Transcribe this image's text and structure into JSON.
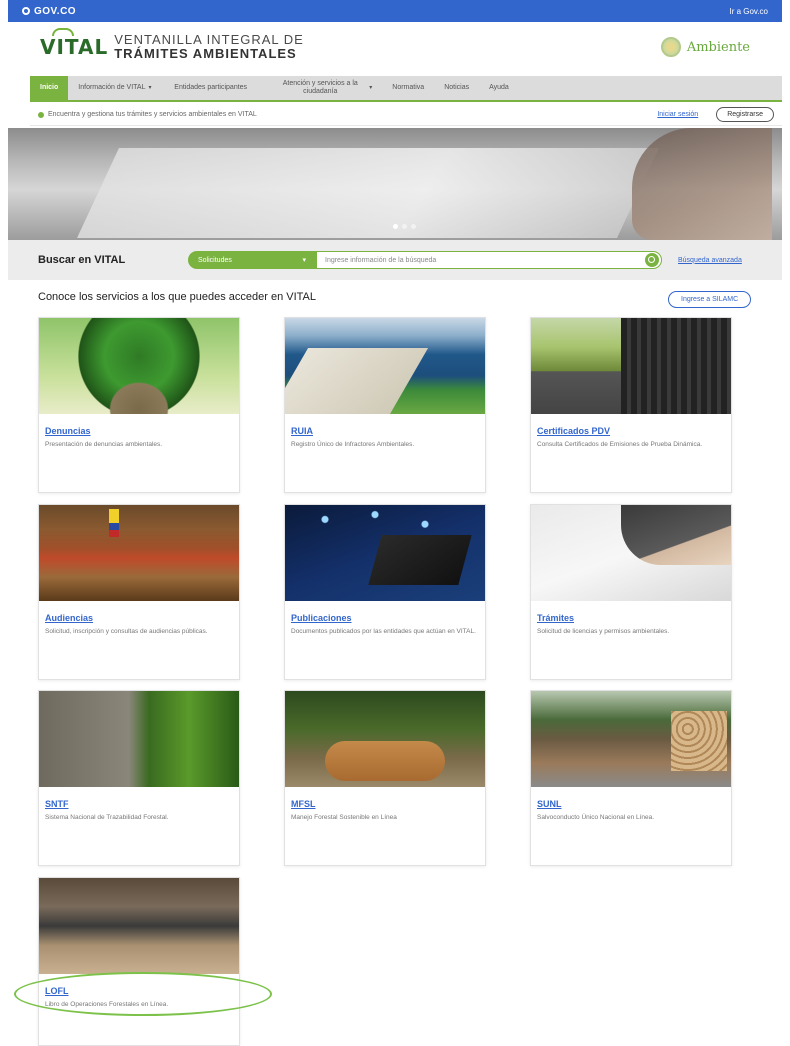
{
  "gov_bar": {
    "logo": "GOV.CO",
    "link": "Ir a Gov.co"
  },
  "brand": {
    "logo": "VITAL",
    "line1": "VENTANILLA INTEGRAL DE",
    "line2": "TRÁMITES AMBIENTALES",
    "ministry": "Ambiente"
  },
  "nav": {
    "items": [
      {
        "label": "Inicio"
      },
      {
        "label": "Información de VITAL",
        "caret": "▾"
      },
      {
        "label": "Entidades participantes"
      },
      {
        "label": "Atención y servicios a la ciudadanía",
        "caret": "▾"
      },
      {
        "label": "Normativa"
      },
      {
        "label": "Noticias"
      },
      {
        "label": "Ayuda"
      }
    ]
  },
  "info_bar": {
    "message": "Encuentra y gestiona tus trámites y servicios ambientales en VITAL",
    "login": "Iniciar sesión",
    "register": "Registrarse"
  },
  "search": {
    "label": "Buscar en VITAL",
    "select_value": "Solicitudes",
    "placeholder": "Ingrese información de la búsqueda",
    "advanced": "Búsqueda avanzada"
  },
  "services": {
    "title": "Conoce los servicios a los que puedes acceder en VITAL",
    "silamc_button": "Ingrese a SILAMC",
    "cards": [
      {
        "title": "Denuncias",
        "desc": "Presentación de denuncias ambientales."
      },
      {
        "title": "RUIA",
        "desc": "Registro Único de Infractores Ambientales."
      },
      {
        "title": "Certificados PDV",
        "desc": "Consulta Certificados de Emisiones de Prueba Dinámica."
      },
      {
        "title": "Audiencias",
        "desc": "Solicitud, inscripción y consultas de audiencias públicas."
      },
      {
        "title": "Publicaciones",
        "desc": "Documentos publicados por las entidades que actúan en VITAL."
      },
      {
        "title": "Trámites",
        "desc": "Solicitud de licencias y permisos ambientales."
      },
      {
        "title": "SNTF",
        "desc": "Sistema Nacional de Trazabilidad Forestal."
      },
      {
        "title": "MFSL",
        "desc": "Manejo Forestal Sostenible en Línea"
      },
      {
        "title": "SUNL",
        "desc": "Salvoconducto Único Nacional en Línea."
      },
      {
        "title": "LOFL",
        "desc": "Libro de Operaciones Forestales en Línea."
      }
    ]
  },
  "colors": {
    "gov_blue": "#3366cc",
    "accent_green": "#7bb341",
    "link_blue": "#3366cc"
  }
}
